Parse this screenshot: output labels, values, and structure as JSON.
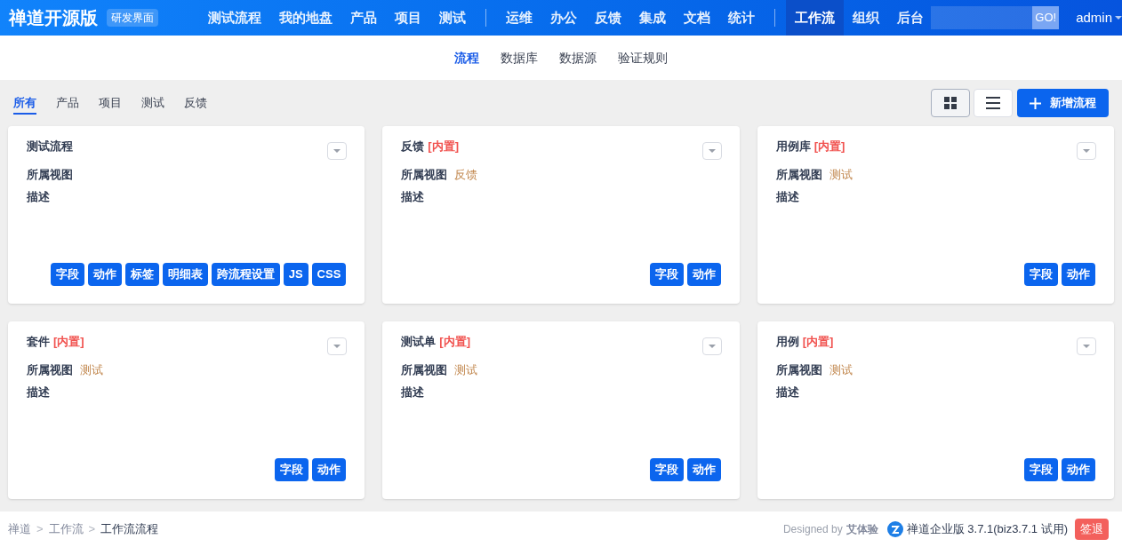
{
  "header": {
    "brand": "禅道开源版",
    "badge": "研发界面",
    "nav_groups": [
      [
        {
          "label": "测试流程",
          "selected": false
        },
        {
          "label": "我的地盘",
          "selected": false
        },
        {
          "label": "产品",
          "selected": false
        },
        {
          "label": "项目",
          "selected": false
        },
        {
          "label": "测试",
          "selected": false
        }
      ],
      [
        {
          "label": "运维",
          "selected": false
        },
        {
          "label": "办公",
          "selected": false
        },
        {
          "label": "反馈",
          "selected": false
        },
        {
          "label": "集成",
          "selected": false
        },
        {
          "label": "文档",
          "selected": false
        },
        {
          "label": "统计",
          "selected": false
        }
      ],
      [
        {
          "label": "工作流",
          "selected": true
        },
        {
          "label": "组织",
          "selected": false
        },
        {
          "label": "后台",
          "selected": false
        }
      ]
    ],
    "search_button": "GO!",
    "user": "admin"
  },
  "subnav": [
    {
      "label": "流程",
      "selected": true
    },
    {
      "label": "数据库",
      "selected": false
    },
    {
      "label": "数据源",
      "selected": false
    },
    {
      "label": "验证规则",
      "selected": false
    }
  ],
  "filters": [
    {
      "label": "所有",
      "selected": true
    },
    {
      "label": "产品",
      "selected": false
    },
    {
      "label": "项目",
      "selected": false
    },
    {
      "label": "测试",
      "selected": false
    },
    {
      "label": "反馈",
      "selected": false
    }
  ],
  "views": [
    {
      "kind": "grid",
      "selected": true
    },
    {
      "kind": "list",
      "selected": false
    }
  ],
  "add_button": "新增流程",
  "cards": [
    {
      "title": "测试流程",
      "view_label": "所属视图",
      "desc_label": "描述",
      "buttons": [
        "字段",
        "动作",
        "标签",
        "明细表",
        "跨流程设置",
        "JS",
        "CSS"
      ]
    },
    {
      "title": "反馈",
      "tag": "[内置]",
      "view_label": "所属视图",
      "view": "反馈",
      "desc_label": "描述",
      "buttons": [
        "字段",
        "动作"
      ]
    },
    {
      "title": "用例库",
      "tag": "[内置]",
      "view_label": "所属视图",
      "view": "测试",
      "desc_label": "描述",
      "buttons": [
        "字段",
        "动作"
      ]
    },
    {
      "title": "套件",
      "tag": "[内置]",
      "view_label": "所属视图",
      "view": "测试",
      "desc_label": "描述",
      "buttons": [
        "字段",
        "动作"
      ]
    },
    {
      "title": "测试单",
      "tag": "[内置]",
      "view_label": "所属视图",
      "view": "测试",
      "desc_label": "描述",
      "buttons": [
        "字段",
        "动作"
      ]
    },
    {
      "title": "用例",
      "tag": "[内置]",
      "view_label": "所属视图",
      "view": "测试",
      "desc_label": "描述",
      "buttons": [
        "字段",
        "动作"
      ]
    }
  ],
  "footer": {
    "breadcrumb": [
      {
        "label": "禅道"
      },
      {
        "label": "工作流"
      },
      {
        "label": "工作流流程"
      }
    ],
    "separator": ">",
    "designed_by": "Designed by",
    "designer": "艾体验",
    "version": "禅道企业版 3.7.1(biz3.7.1 试用)",
    "logout": "签退"
  }
}
